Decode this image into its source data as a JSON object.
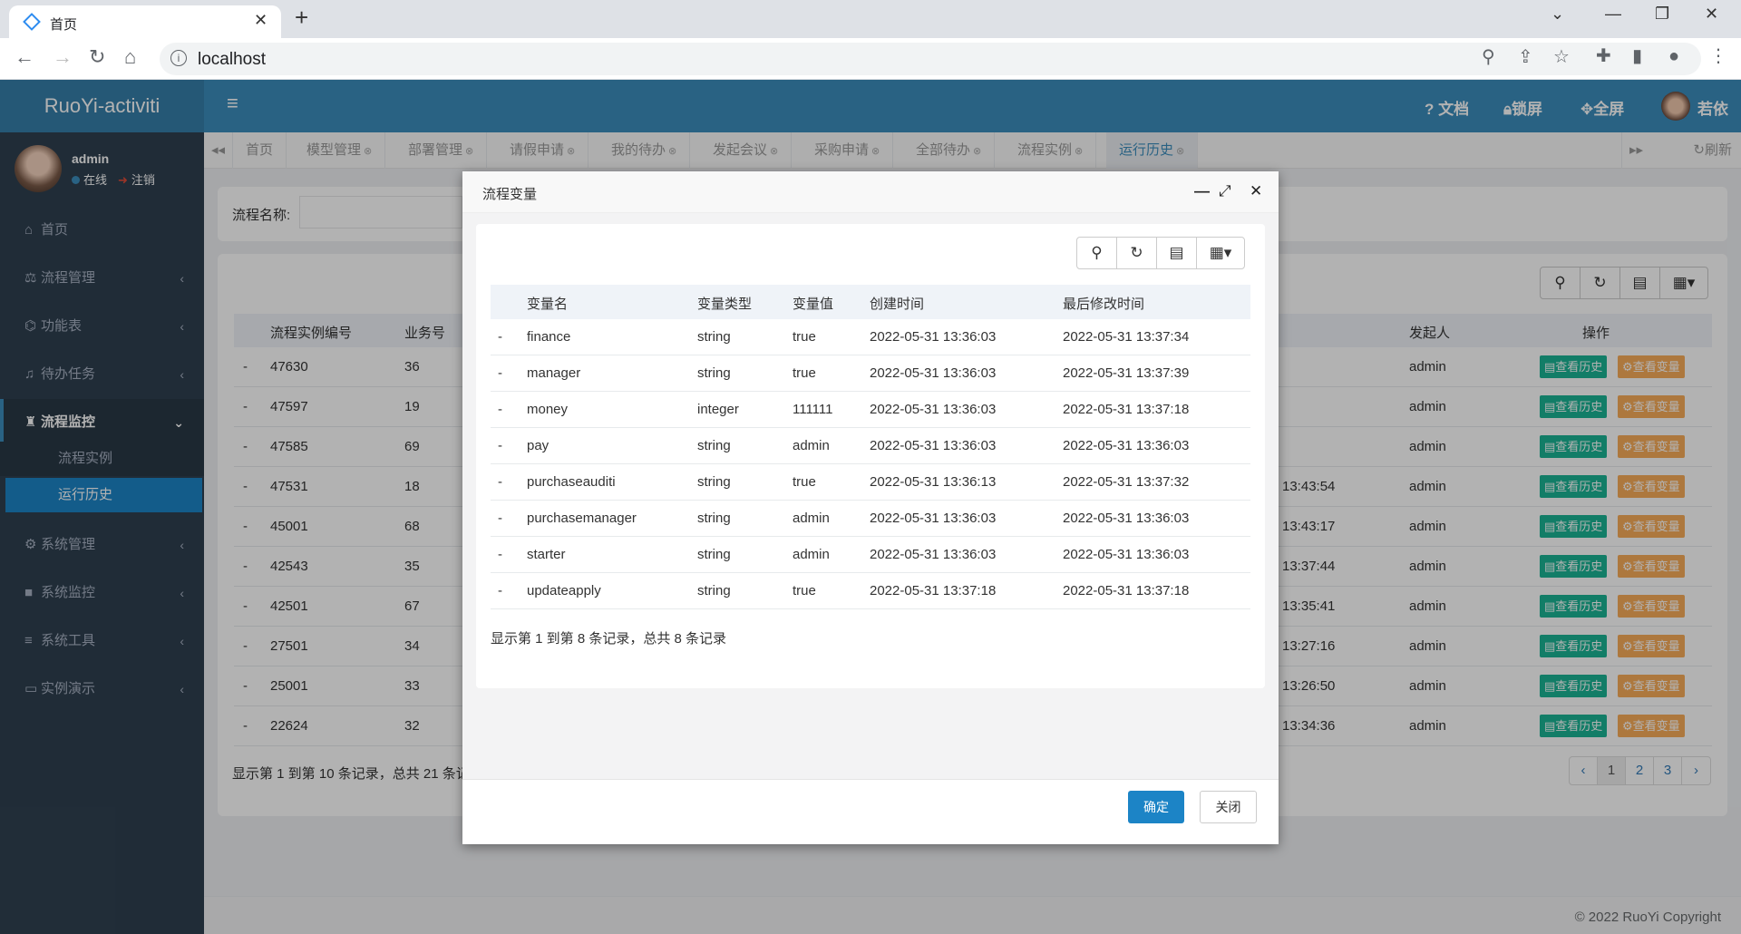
{
  "browser": {
    "tab_title": "首页",
    "url": "localhost"
  },
  "app": {
    "logo": "RuoYi-activiti",
    "user_name": "admin",
    "status_online": "在线",
    "status_logout": "注销",
    "top_doc": "文档",
    "top_lock": "锁屏",
    "top_full": "全屏",
    "top_user": "若依",
    "refresh": "刷新",
    "copyright": "© 2022 RuoYi Copyright"
  },
  "sidebar": {
    "items": [
      {
        "label": "首页",
        "icon": "home-icon"
      },
      {
        "label": "流程管理",
        "icon": "scale-icon"
      },
      {
        "label": "功能表",
        "icon": "bank-icon"
      },
      {
        "label": "待办任务",
        "icon": "bell-icon"
      },
      {
        "label": "流程监控",
        "icon": "binoculars-icon"
      },
      {
        "label": "系统管理",
        "icon": "gear-icon"
      },
      {
        "label": "系统监控",
        "icon": "video-icon"
      },
      {
        "label": "系统工具",
        "icon": "bars-icon"
      },
      {
        "label": "实例演示",
        "icon": "desktop-icon"
      }
    ],
    "sub_items": [
      "流程实例",
      "运行历史"
    ]
  },
  "page_tabs": [
    "首页",
    "模型管理",
    "部署管理",
    "请假申请",
    "我的待办",
    "发起会议",
    "采购申请",
    "全部待办",
    "流程实例",
    "运行历史"
  ],
  "search": {
    "label": "流程名称:"
  },
  "bg_table": {
    "headers": [
      "流程实例编号",
      "业务号",
      "发起人",
      "操作"
    ],
    "rows": [
      {
        "dash": "-",
        "id": "47630",
        "biz": "36",
        "time": "",
        "user": "admin"
      },
      {
        "dash": "-",
        "id": "47597",
        "biz": "19",
        "time": "",
        "user": "admin"
      },
      {
        "dash": "-",
        "id": "47585",
        "biz": "69",
        "time": "",
        "user": "admin"
      },
      {
        "dash": "-",
        "id": "47531",
        "biz": "18",
        "time": "13:43:54",
        "user": "admin"
      },
      {
        "dash": "-",
        "id": "45001",
        "biz": "68",
        "time": "13:43:17",
        "user": "admin"
      },
      {
        "dash": "-",
        "id": "42543",
        "biz": "35",
        "time": "13:37:44",
        "user": "admin"
      },
      {
        "dash": "-",
        "id": "42501",
        "biz": "67",
        "time": "13:35:41",
        "user": "admin"
      },
      {
        "dash": "-",
        "id": "27501",
        "biz": "34",
        "time": "13:27:16",
        "user": "admin"
      },
      {
        "dash": "-",
        "id": "25001",
        "biz": "33",
        "time": "13:26:50",
        "user": "admin"
      },
      {
        "dash": "-",
        "id": "22624",
        "biz": "32",
        "time": "13:34:36",
        "user": "admin"
      }
    ],
    "btn_history": "查看历史",
    "btn_vars": "查看变量",
    "footer": "显示第 1 到第 10 条记录，总共 21 条记",
    "pages": [
      "‹",
      "1",
      "2",
      "3",
      "›"
    ]
  },
  "modal": {
    "title": "流程变量",
    "headers": [
      "变量名",
      "变量类型",
      "变量值",
      "创建时间",
      "最后修改时间"
    ],
    "rows": [
      {
        "dash": "-",
        "name": "finance",
        "type": "string",
        "value": "true",
        "created": "2022-05-31 13:36:03",
        "modified": "2022-05-31 13:37:34"
      },
      {
        "dash": "-",
        "name": "manager",
        "type": "string",
        "value": "true",
        "created": "2022-05-31 13:36:03",
        "modified": "2022-05-31 13:37:39"
      },
      {
        "dash": "-",
        "name": "money",
        "type": "integer",
        "value": "111111",
        "created": "2022-05-31 13:36:03",
        "modified": "2022-05-31 13:37:18"
      },
      {
        "dash": "-",
        "name": "pay",
        "type": "string",
        "value": "admin",
        "created": "2022-05-31 13:36:03",
        "modified": "2022-05-31 13:36:03"
      },
      {
        "dash": "-",
        "name": "purchaseauditi",
        "type": "string",
        "value": "true",
        "created": "2022-05-31 13:36:13",
        "modified": "2022-05-31 13:37:32"
      },
      {
        "dash": "-",
        "name": "purchasemanager",
        "type": "string",
        "value": "admin",
        "created": "2022-05-31 13:36:03",
        "modified": "2022-05-31 13:36:03"
      },
      {
        "dash": "-",
        "name": "starter",
        "type": "string",
        "value": "admin",
        "created": "2022-05-31 13:36:03",
        "modified": "2022-05-31 13:36:03"
      },
      {
        "dash": "-",
        "name": "updateapply",
        "type": "string",
        "value": "true",
        "created": "2022-05-31 13:37:18",
        "modified": "2022-05-31 13:37:18"
      }
    ],
    "footer": "显示第 1 到第 8 条记录，总共 8 条记录",
    "ok": "确定",
    "close": "关闭"
  }
}
